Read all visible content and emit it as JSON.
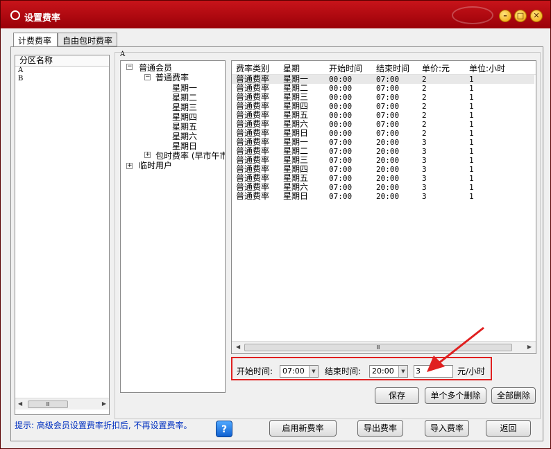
{
  "window": {
    "title": "设置费率"
  },
  "tabs": [
    "计费费率",
    "自由包时费率"
  ],
  "zones": {
    "header": "分区名称",
    "items": [
      "A",
      "B"
    ]
  },
  "group_label": "A",
  "tree": {
    "member": "普通会员",
    "normal_rate": "普通费率",
    "days": [
      "星期一",
      "星期二",
      "星期三",
      "星期四",
      "星期五",
      "星期六",
      "星期日"
    ],
    "package_rate": "包时费率 (早市午市",
    "temp_user": "临时用户"
  },
  "table": {
    "headers": [
      "费率类别",
      "星期",
      "开始时间",
      "结束时间",
      "单价:元",
      "单位:小时"
    ],
    "rows": [
      [
        "普通费率",
        "星期一",
        "00:00",
        "07:00",
        "2",
        "1"
      ],
      [
        "普通费率",
        "星期二",
        "00:00",
        "07:00",
        "2",
        "1"
      ],
      [
        "普通费率",
        "星期三",
        "00:00",
        "07:00",
        "2",
        "1"
      ],
      [
        "普通费率",
        "星期四",
        "00:00",
        "07:00",
        "2",
        "1"
      ],
      [
        "普通费率",
        "星期五",
        "00:00",
        "07:00",
        "2",
        "1"
      ],
      [
        "普通费率",
        "星期六",
        "00:00",
        "07:00",
        "2",
        "1"
      ],
      [
        "普通费率",
        "星期日",
        "00:00",
        "07:00",
        "2",
        "1"
      ],
      [
        "普通费率",
        "星期一",
        "07:00",
        "20:00",
        "3",
        "1"
      ],
      [
        "普通费率",
        "星期二",
        "07:00",
        "20:00",
        "3",
        "1"
      ],
      [
        "普通费率",
        "星期三",
        "07:00",
        "20:00",
        "3",
        "1"
      ],
      [
        "普通费率",
        "星期四",
        "07:00",
        "20:00",
        "3",
        "1"
      ],
      [
        "普通费率",
        "星期五",
        "07:00",
        "20:00",
        "3",
        "1"
      ],
      [
        "普通费率",
        "星期六",
        "07:00",
        "20:00",
        "3",
        "1"
      ],
      [
        "普通费率",
        "星期日",
        "07:00",
        "20:00",
        "3",
        "1"
      ]
    ]
  },
  "edit": {
    "start_label": "开始时间:",
    "start_value": "07:00",
    "end_label": "结束时间:",
    "end_value": "20:00",
    "price_value": "3",
    "unit_label": "元/小时"
  },
  "buttons": {
    "save": "保存",
    "delete_some": "单个多个删除",
    "delete_all": "全部删除",
    "enable_new": "启用新费率",
    "export": "导出费率",
    "import": "导入费率",
    "back": "返回"
  },
  "hint": "提示: 高级会员设置费率折扣后, 不再设置费率。",
  "colors": {
    "title_bar": "#b00a10",
    "highlight_box": "#e02020",
    "hint_text": "#0030c0"
  }
}
